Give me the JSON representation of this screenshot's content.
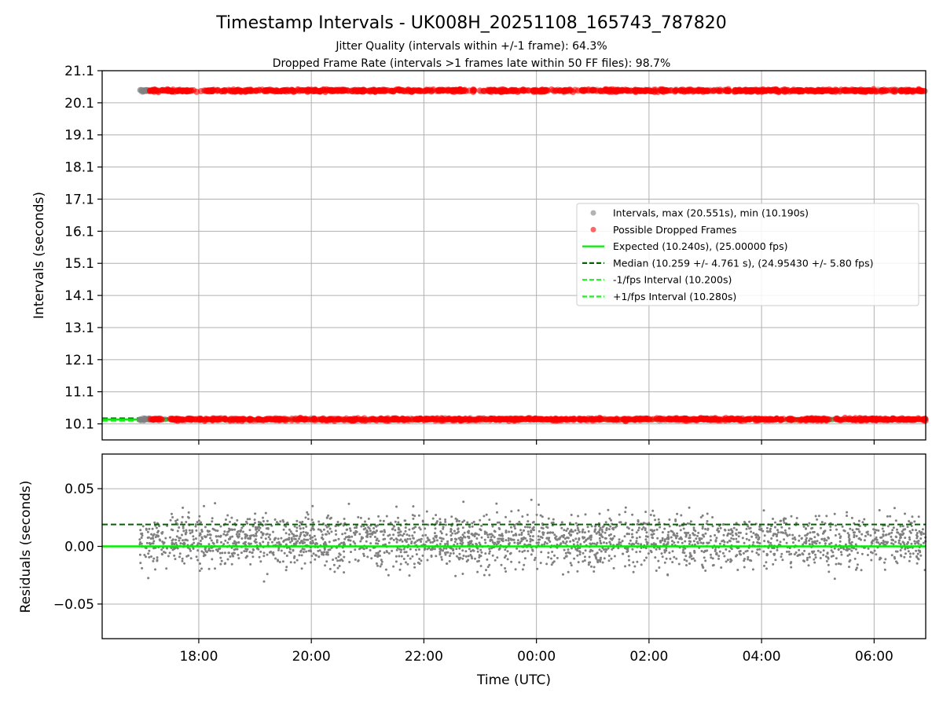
{
  "chart_data": [
    {
      "type": "scatter",
      "title": "Timestamp Intervals - UK008H_20251108_165743_787820",
      "subtitle_1": "Jitter Quality (intervals within +/-1 frame): 64.3%",
      "subtitle_2": "Dropped Frame Rate (intervals >1 frames late within 50 FF files): 98.7%",
      "ylabel": "Intervals (seconds)",
      "ylim": [
        9.6,
        21.1
      ],
      "yticks": [
        "10.1",
        "11.1",
        "12.1",
        "13.1",
        "14.1",
        "15.1",
        "16.1",
        "17.1",
        "18.1",
        "19.1",
        "20.1",
        "21.1"
      ],
      "grid": true,
      "legend_position": "center-right",
      "x_range_hours_utc": [
        "2025-11-08 16:17",
        "2025-11-09 06:55"
      ],
      "series": [
        {
          "name": "Intervals, max (20.551s), min (10.190s)",
          "color": "#808080",
          "kind": "points",
          "bands": [
            {
              "x_start": "2025-11-08 16:57",
              "x_end": "2025-11-09 06:55",
              "y_center": 10.24,
              "spread": 0.06
            },
            {
              "x_start": "2025-11-08 16:57",
              "x_end": "2025-11-09 06:55",
              "y_center": 20.48,
              "spread": 0.06
            }
          ]
        },
        {
          "name": "Possible Dropped Frames",
          "color": "#ff0000",
          "kind": "points",
          "bands": [
            {
              "x_start": "2025-11-08 17:08",
              "x_end": "2025-11-09 06:55",
              "y_center": 10.24,
              "spread": 0.06
            },
            {
              "x_start": "2025-11-08 17:08",
              "x_end": "2025-11-09 06:55",
              "y_center": 20.48,
              "spread": 0.06
            }
          ]
        },
        {
          "name": "Expected (10.240s), (25.00000 fps)",
          "color": "#00ee00",
          "kind": "line",
          "y": 10.24
        },
        {
          "name": "Median (10.259 +/- 4.761 s), (24.95430 +/- 5.80 fps)",
          "color": "#006400",
          "kind": "dashed",
          "y": 10.259
        },
        {
          "name": "-1/fps Interval (10.200s)",
          "color": "#22ee22",
          "kind": "dashed",
          "y": 10.2
        },
        {
          "name": "+1/fps Interval (10.280s)",
          "color": "#22ee22",
          "kind": "dashed",
          "y": 10.28
        }
      ]
    },
    {
      "type": "scatter",
      "ylabel": "Residuals (seconds)",
      "xlabel": "Time (UTC)",
      "ylim": [
        -0.08,
        0.08
      ],
      "yticks": [
        "−0.05",
        "0.00",
        "0.05"
      ],
      "xticks": [
        "18:00",
        "20:00",
        "22:00",
        "00:00",
        "02:00",
        "04:00",
        "06:00"
      ],
      "grid": true,
      "series": [
        {
          "name": "residuals",
          "color": "#808080",
          "kind": "points",
          "x_start": "2025-11-08 16:57",
          "x_end": "2025-11-09 06:55",
          "y_center": 0.005,
          "y_min": -0.05,
          "y_max": 0.065
        },
        {
          "name": "expected",
          "color": "#00ee00",
          "kind": "line",
          "y": 0.0
        },
        {
          "name": "median",
          "color": "#006400",
          "kind": "dashed",
          "y": 0.019
        }
      ]
    }
  ]
}
